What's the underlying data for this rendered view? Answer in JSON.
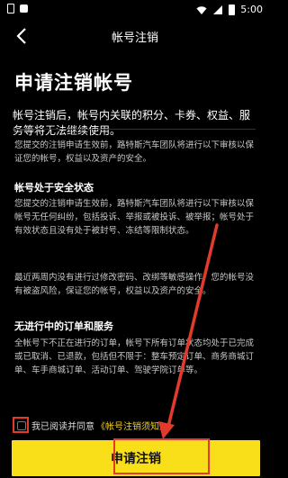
{
  "status_bar": {
    "time": "5:00"
  },
  "nav": {
    "title": "帐号注销"
  },
  "heading": "申请注销帐号",
  "intro": "帐号注销后，帐号内关联的积分、卡券、权益、服务等将无法继续使用。",
  "review_notice": "您提交的注销申请生效前，路特斯汽车团队将进行以下审核以保证您的帐号，权益以及资产的安全。",
  "section1": {
    "title": "帐号处于安全状态",
    "para1": "您提交的注销申请生效前，路特斯汽车团队将进行以下审核以保帐号无任何纠纷，包括投诉、举报或被投诉、被举报；帐号处于有效状态且没有处于被封号、冻结等限制状态。",
    "para2": "最近两周内没有进行过修改密码、改绑等敏感操作，您的帐号没有被盗风险，保证您的帐号，权益以及资产的安全。"
  },
  "section2": {
    "title": "无进行中的订单和服务",
    "para": "全帐号下不正在进行的订单，帐号下所有订单状态均处于已完成或已取消、已退款，包括但不限于：整车预定订单、商务商城订单、车手商城订单、活动订单、驾驶学院订单等。"
  },
  "agreement": {
    "text": "我已阅读并同意",
    "link": "《帐号注销须知》"
  },
  "submit_label": "申请注销",
  "colors": {
    "accent": "#f8df19",
    "annotation": "#e23b2e",
    "background": "#000000"
  }
}
